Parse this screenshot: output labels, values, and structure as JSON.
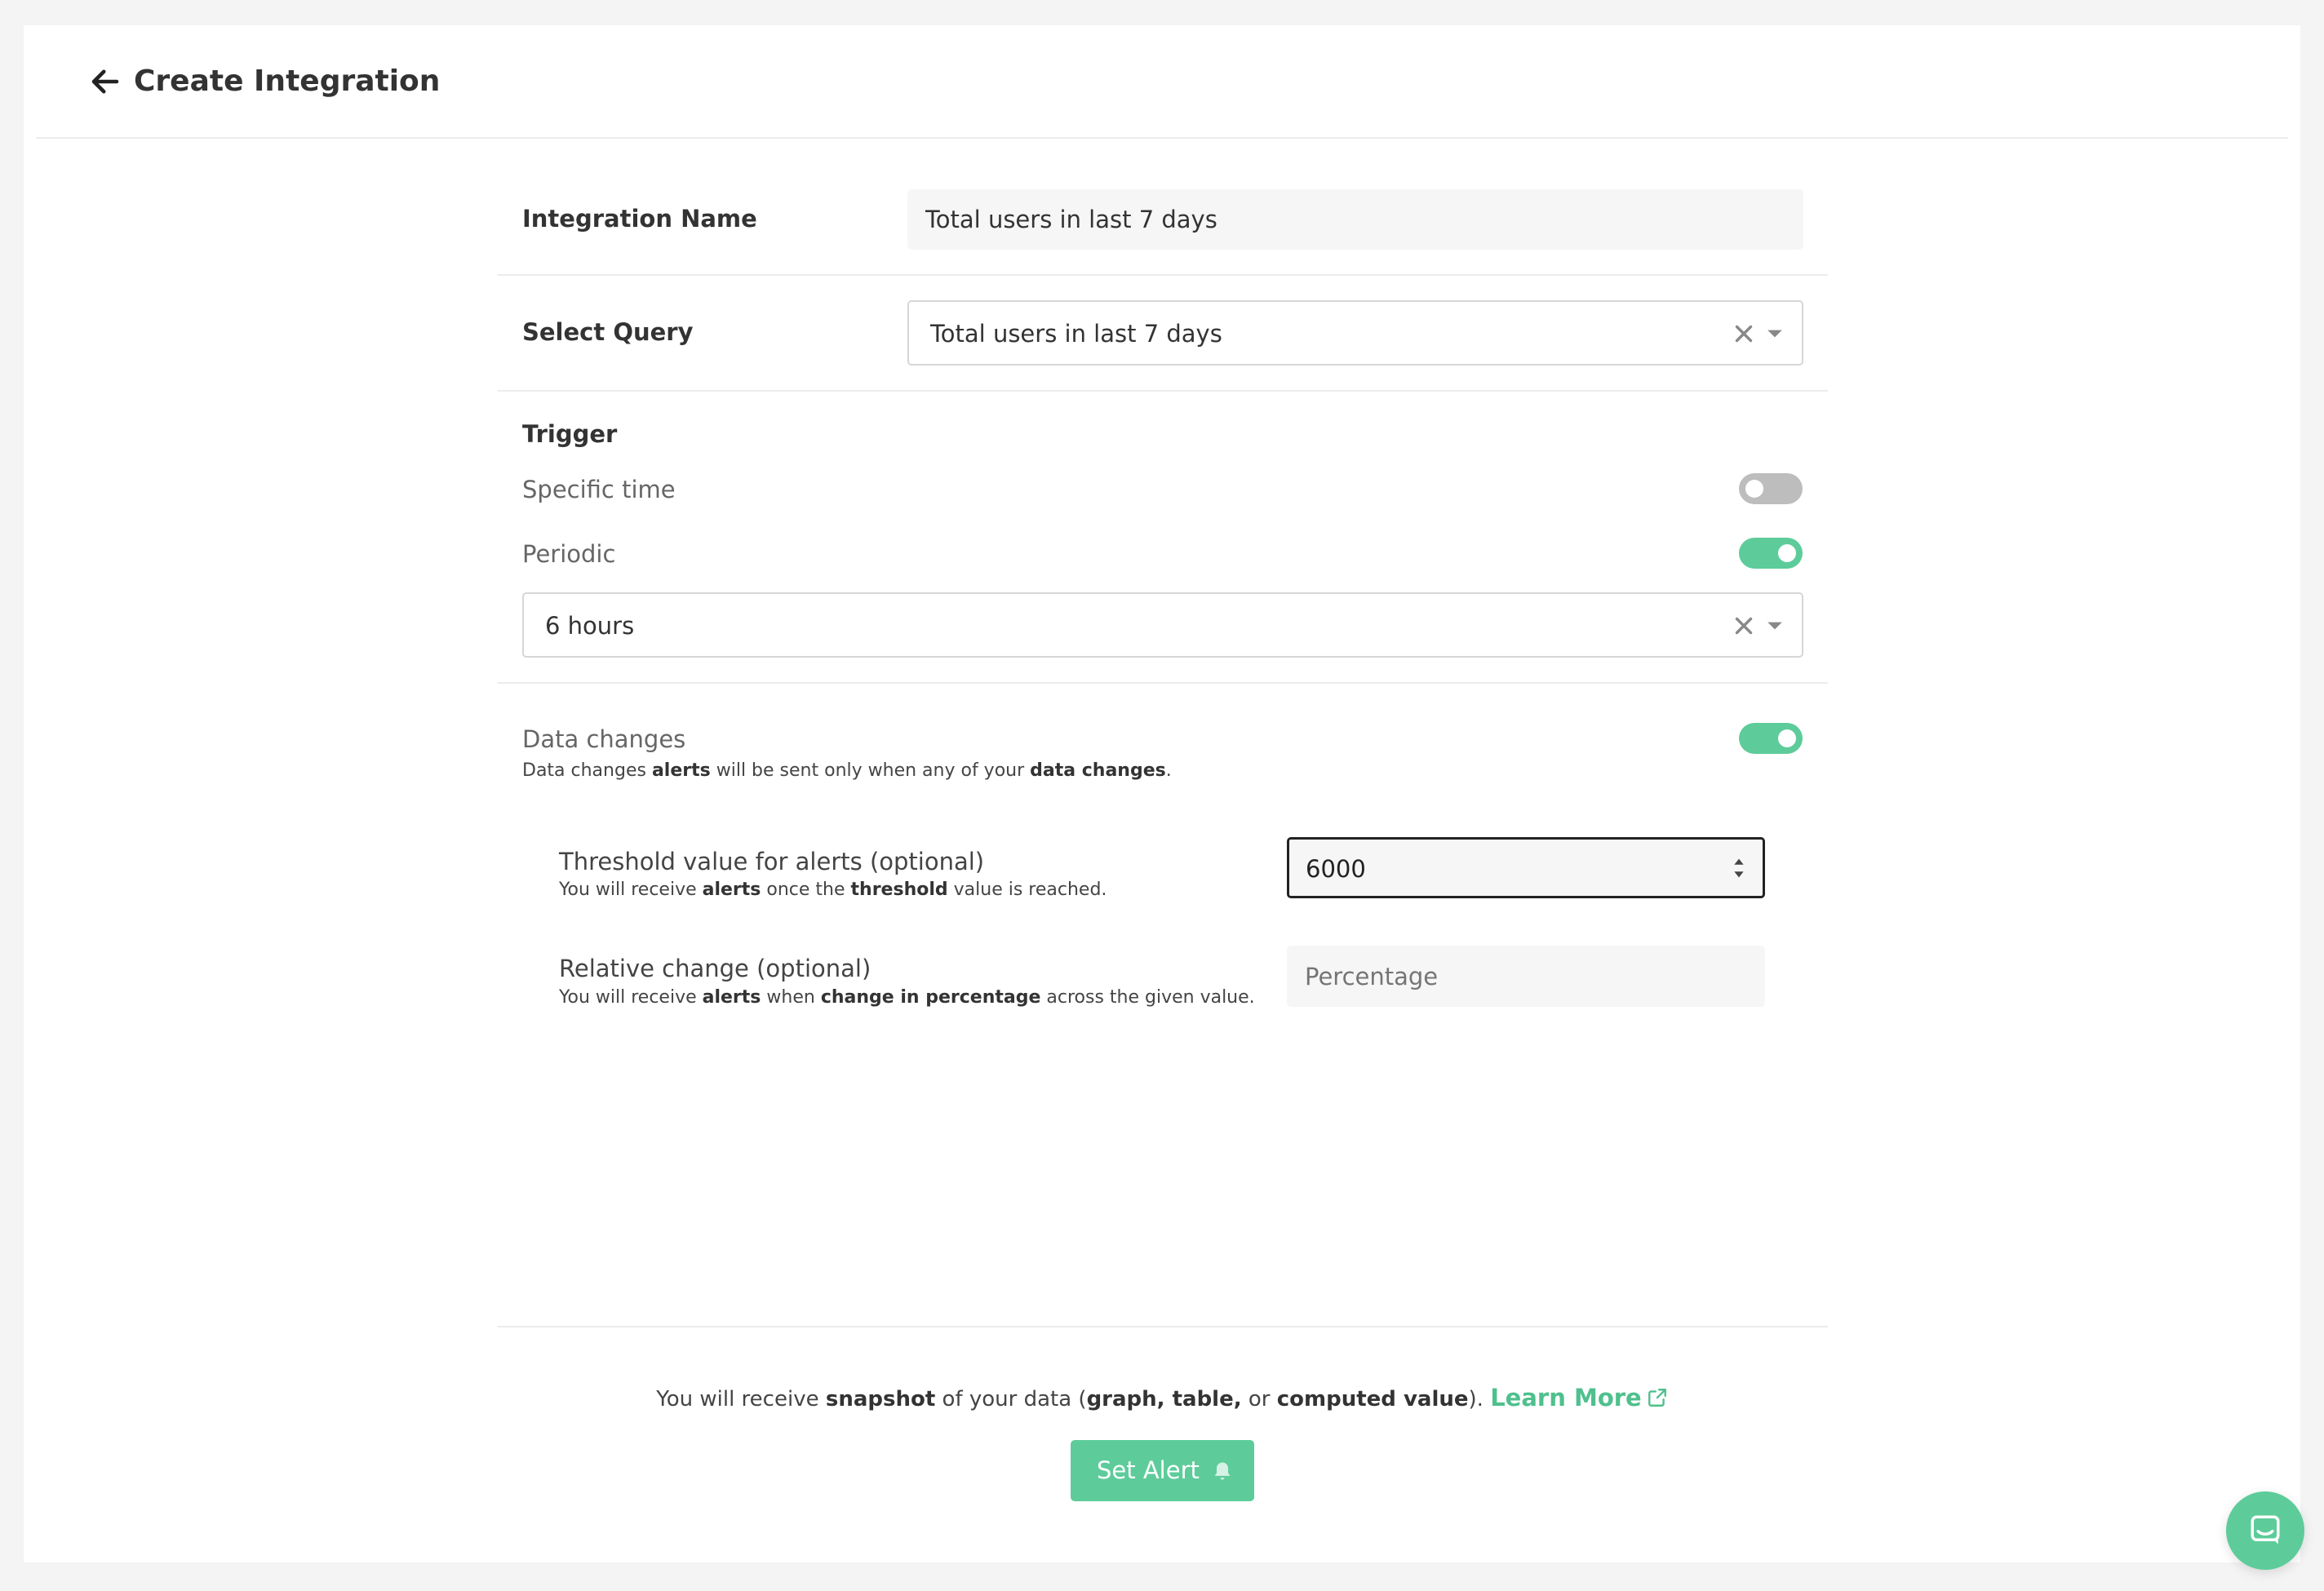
{
  "header": {
    "title": "Create Integration",
    "back_icon": "arrow-left-icon"
  },
  "form": {
    "integration_name": {
      "label": "Integration Name",
      "value": "Total users in last 7 days"
    },
    "select_query": {
      "label": "Select Query",
      "value": "Total users in last 7 days",
      "clear_icon": "close-icon",
      "dropdown_icon": "caret-down-icon"
    },
    "trigger": {
      "label": "Trigger",
      "specific_time": {
        "label": "Specific time",
        "enabled": false
      },
      "periodic": {
        "label": "Periodic",
        "enabled": true
      },
      "interval": {
        "value": "6 hours",
        "clear_icon": "close-icon",
        "dropdown_icon": "caret-down-icon"
      }
    },
    "data_changes": {
      "label": "Data changes",
      "enabled": true,
      "help": {
        "p1": "Data changes ",
        "b1": "alerts",
        "p2": " will be sent only when any of your ",
        "b2": "data changes",
        "p3": "."
      }
    },
    "threshold": {
      "label": "Threshold value for alerts (optional)",
      "value": "6000",
      "help": {
        "p1": "You will receive ",
        "b1": "alerts",
        "p2": " once the ",
        "b2": "threshold",
        "p3": " value is reached."
      }
    },
    "relative_change": {
      "label": "Relative change (optional)",
      "placeholder": "Percentage",
      "help": {
        "p1": "You will receive ",
        "b1": "alerts",
        "p2": " when ",
        "b2": "change in percentage",
        "p3": " across the given value."
      }
    }
  },
  "footer": {
    "p1": "You will receive ",
    "b1": "snapshot",
    "p2": " of your data (",
    "b2": "graph, table,",
    "p3": " or ",
    "b3": "computed value",
    "p4": "). ",
    "learn_more": "Learn More",
    "set_alert_label": "Set Alert"
  },
  "colors": {
    "accent": "#5dcc9a",
    "link": "#4fc08d",
    "toggle_off": "#bdbdbd"
  },
  "icons": {
    "set_alert": "bell-icon",
    "learn_more": "external-link-icon",
    "chat": "chat-icon"
  }
}
